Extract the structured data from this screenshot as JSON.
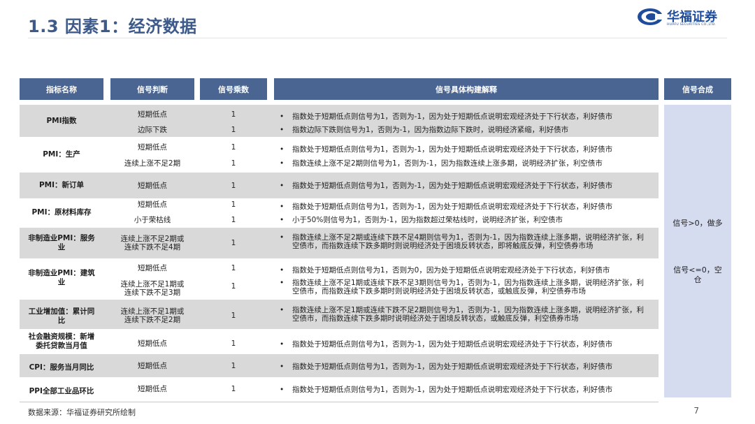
{
  "title": "1.3 因素1：经济数据",
  "logo": {
    "name_cn": "华福证券",
    "name_en": "HUAFU SECURITIES CO.,LTD."
  },
  "headers": {
    "name": "指标名称",
    "judge": "信号判断",
    "mult": "信号乘数",
    "expl": "信号具体构建解释",
    "synth": "信号合成"
  },
  "rows": [
    {
      "name": "PMI指数",
      "lines": [
        {
          "judge": "短期低点",
          "mult": "1",
          "expl": "指数处于短期低点则信号为1，否则为-1，因为处于短期低点说明宏观经济处于下行状态，利好债市"
        },
        {
          "judge": "边际下跌",
          "mult": "1",
          "expl": "指数边际下跌则信号为1，否则为-1，因为指数边际下跌时，说明经济紧缩，利好债市"
        }
      ]
    },
    {
      "name": "PMI：生产",
      "lines": [
        {
          "judge": "短期低点",
          "mult": "1",
          "expl": "指数处于短期低点则信号为1，否则为-1，因为处于短期低点说明宏观经济处于下行状态，利好债市"
        },
        {
          "judge": "连续上涨不足2期",
          "mult": "1",
          "expl": "指数连续上涨不足2期则信号为1，否则为-1，因为指数连续上涨多期，说明经济扩张，利空债市"
        }
      ]
    },
    {
      "name": "PMI：新订单",
      "lines": [
        {
          "judge": "短期低点",
          "mult": "1",
          "expl": "指数处于短期低点则信号为1，否则为-1，因为处于短期低点说明宏观经济处于下行状态，利好债市"
        }
      ]
    },
    {
      "name": "PMI：原材料库存",
      "lines": [
        {
          "judge": "短期低点",
          "mult": "1",
          "expl": "指数处于短期低点则信号为1，否则为-1，因为处于短期低点说明宏观经济处于下行状态，利好债市"
        },
        {
          "judge": "小于荣枯线",
          "mult": "1",
          "expl": "小于50%则信号为1，否则为-1，因为指数超过荣枯线时，说明经济扩张，利空债市"
        }
      ]
    },
    {
      "name": "非制造业PMI：服务业",
      "lines": [
        {
          "judge": "连续上涨不足2期或连续下跌不足4期",
          "mult": "1",
          "expl": "指数连续上涨不足2期或连续下跌不足4期则信号为1，否则为-1，因为指数连续上涨多期，说明经济扩张，利空债市，而指数连续下跌多期时则说明经济处于困境反转状态，即将触底反弹，利空债券市场"
        }
      ]
    },
    {
      "name": "非制造业PMI：建筑业",
      "lines": [
        {
          "judge": "短期低点",
          "mult": "1",
          "expl": "指数处于短期低点则信号为1，否则为0，因为处于短期低点说明宏观经济处于下行状态，利好债市"
        },
        {
          "judge": "连续上涨不足1期或连续下跌不足3期",
          "mult": "1",
          "expl": "指数连续上涨不足1期或连续下跌不足3期则信号为1，否则为-1，因为指数连续上涨多期，说明经济扩张，利空债市，而指数连续下跌多期时则说明经济处于困境反转状态，或触底反弹，利空债券市场"
        }
      ]
    },
    {
      "name": "工业增加值：累计同比",
      "lines": [
        {
          "judge": "连续上涨不足1期或连续下跌不足2期",
          "mult": "1",
          "expl": "指数连续上涨不足1期或连续下跌不足2期则信号为1，否则为-1，因为指数连续上涨多期，说明经济扩张，利空债市，而指数连续下跌多期时说明经济处于困境反转状态，或触底反弹，利空债券市场"
        }
      ]
    },
    {
      "name": "社会融资规模：新增委托贷款当月值",
      "lines": [
        {
          "judge": "短期低点",
          "mult": "1",
          "expl": "指数处于短期低点则信号为1，否则为-1，因为处于短期低点说明宏观经济处于下行状态，利好债市"
        }
      ]
    },
    {
      "name": "CPI：服务当月同比",
      "lines": [
        {
          "judge": "短期低点",
          "mult": "1",
          "expl": "指数处于短期低点则信号为1，否则为-1，因为处于短期低点说明宏观经济处于下行状态，利好债市"
        }
      ]
    },
    {
      "name": "PPI全部工业品环比",
      "lines": [
        {
          "judge": "短期低点",
          "mult": "1",
          "expl": "指数处于短期低点则信号为1，否则为-1，因为处于短期低点说明宏观经济处于下行状态，利好债市"
        }
      ]
    }
  ],
  "bullet": "•",
  "synthesis": {
    "line1": "信号>0，做多",
    "line2": "信号<=0，空仓"
  },
  "footer": {
    "source": "数据来源：华福证券研究所绘制",
    "page": "7"
  }
}
